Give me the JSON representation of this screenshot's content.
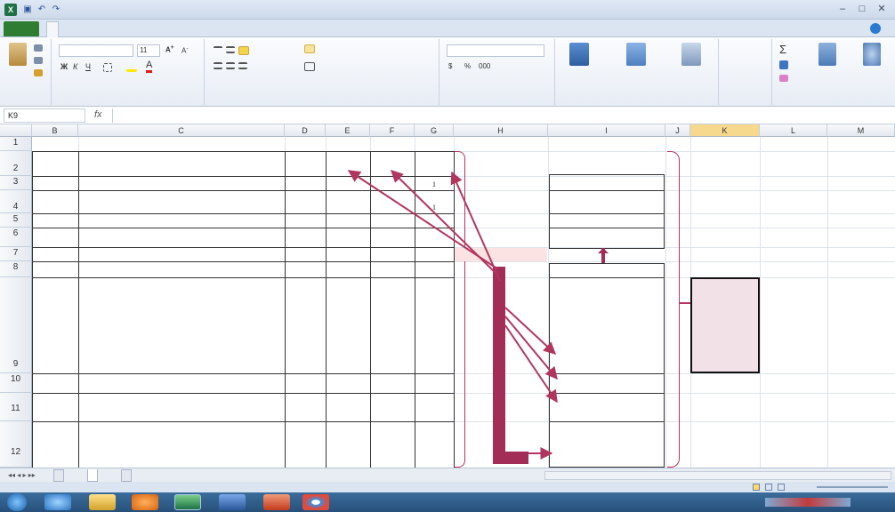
{
  "window": {
    "title": "",
    "min": "–",
    "max": "□",
    "close": "✕"
  },
  "qat": [
    "▣",
    "↶",
    "↷"
  ],
  "ribbon_tabs": {
    "file": "",
    "items": [
      "",
      "",
      "",
      "",
      "",
      "",
      "",
      ""
    ]
  },
  "ribbon": {
    "font_name": "",
    "font_size": "11",
    "paste_label": "",
    "groups": [
      "",
      "",
      "",
      "",
      "",
      "",
      "",
      ""
    ],
    "cells_buttons": [
      "",
      "",
      ""
    ],
    "edit_buttons": [
      "Σ",
      "",
      ""
    ]
  },
  "formula_bar": {
    "name_box": "K9",
    "fx": "fx",
    "content": ""
  },
  "columns": [
    "B",
    "C",
    "D",
    "E",
    "F",
    "G",
    "H",
    "I",
    "J",
    "K",
    "L",
    "M"
  ],
  "rows": [
    "1",
    "2",
    "3",
    "4",
    "5",
    "6",
    "7",
    "8",
    "9",
    "10",
    "11",
    "12"
  ],
  "sheet": {
    "title_c1": "",
    "headers": {
      "b": "",
      "c": "",
      "d": "",
      "e": "",
      "f": "",
      "g": ""
    },
    "table": [
      {
        "b": "",
        "c": "",
        "d": "",
        "e": "",
        "f": "",
        "g": "1"
      },
      {
        "b": "",
        "c": "",
        "d": "",
        "e": "",
        "f": "",
        "g": "1"
      },
      {
        "b": "",
        "c": "",
        "d": "",
        "e": "",
        "f": "",
        "g": ""
      },
      {
        "b": "",
        "c": "",
        "d": "",
        "e": "",
        "f": "",
        "g": ""
      },
      {
        "b": "",
        "c": "",
        "d": "",
        "e": "",
        "f": "",
        "g": ""
      },
      {
        "b": "",
        "c": "",
        "d": "",
        "e": "",
        "f": "",
        "g": ""
      },
      {
        "b": "",
        "c": "",
        "d": "",
        "e": "",
        "f": "",
        "g": ""
      },
      {
        "b": "",
        "c": "",
        "d": "",
        "e": "",
        "f": "",
        "g": ""
      },
      {
        "b": "",
        "c": "",
        "d": "",
        "e": "",
        "f": "",
        "g": ""
      },
      {
        "b": "",
        "c": "",
        "d": "",
        "e": "",
        "f": "",
        "g": ""
      }
    ],
    "callout_h7": "",
    "formulas": {
      "title": "",
      "kv": "",
      "km": "",
      "ki": ""
    },
    "legend": {
      "title": "",
      "items": [
        "",
        "",
        "",
        ""
      ]
    },
    "k_box": ""
  },
  "sheet_tabs": [
    "",
    "",
    ""
  ],
  "status": {
    "left": "",
    "zoom": ""
  },
  "taskbar": {
    "clock": ""
  }
}
